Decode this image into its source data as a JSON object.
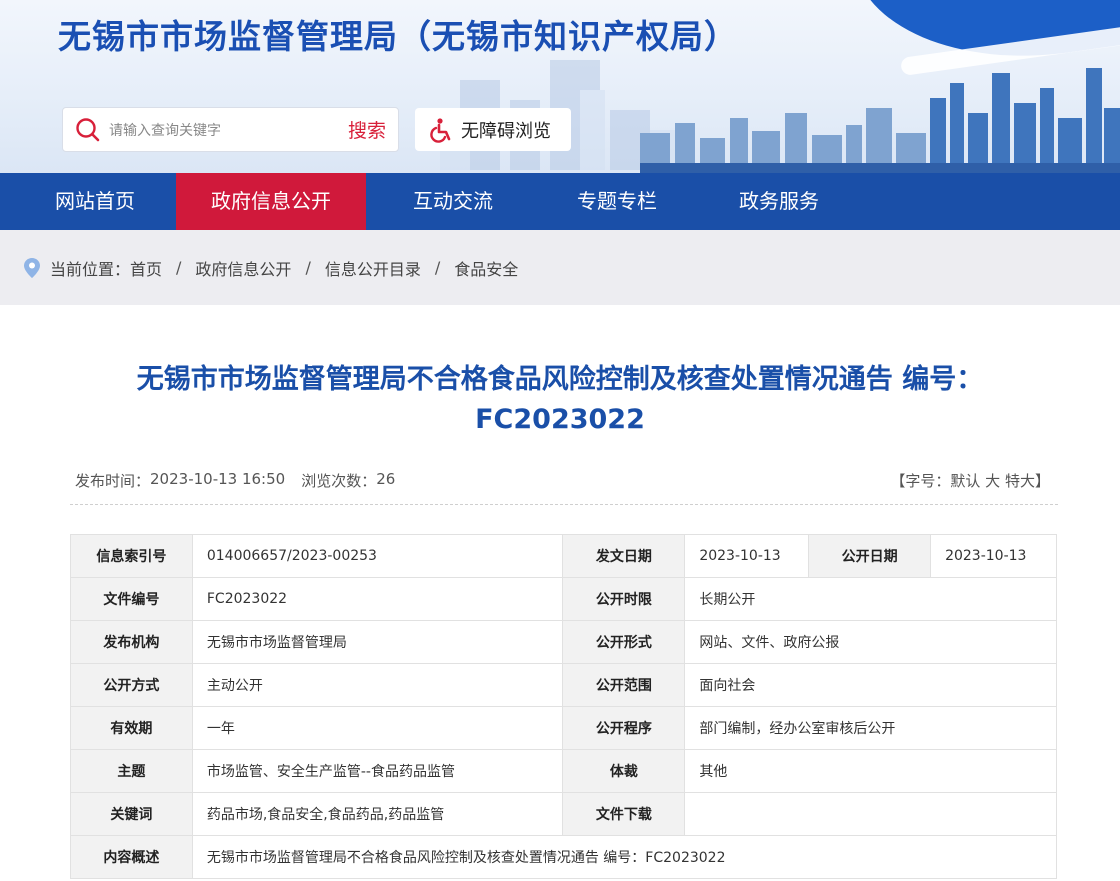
{
  "header": {
    "site_title": "无锡市市场监督管理局（无锡市知识产权局）",
    "search_placeholder": "请输入查询关键字",
    "search_button": "搜索",
    "accessibility_label": "无障碍浏览"
  },
  "nav": {
    "items": [
      {
        "label": "网站首页"
      },
      {
        "label": "政府信息公开"
      },
      {
        "label": "互动交流"
      },
      {
        "label": "专题专栏"
      },
      {
        "label": "政务服务"
      }
    ]
  },
  "breadcrumb": {
    "prefix": "当前位置：",
    "items": [
      "首页",
      "政府信息公开",
      "信息公开目录",
      "食品安全"
    ],
    "separator": "/"
  },
  "article": {
    "title": "无锡市市场监督管理局不合格食品风险控制及核查处置情况通告 编号：FC2023022",
    "publish_label": "发布时间：",
    "publish_time": "2023-10-13 16:50",
    "views_label": "浏览次数：",
    "views": "26",
    "font_size_prefix": "【字号：",
    "font_default": "默认",
    "font_large": "大",
    "font_xlarge": "特大",
    "font_size_suffix": "】"
  },
  "info_table": {
    "index_no": {
      "label": "信息索引号",
      "value": "014006657/2023-00253"
    },
    "issue_date": {
      "label": "发文日期",
      "value": "2023-10-13"
    },
    "open_date": {
      "label": "公开日期",
      "value": "2023-10-13"
    },
    "doc_no": {
      "label": "文件编号",
      "value": "FC2023022"
    },
    "open_period": {
      "label": "公开时限",
      "value": "长期公开"
    },
    "publisher": {
      "label": "发布机构",
      "value": "无锡市市场监督管理局"
    },
    "open_form": {
      "label": "公开形式",
      "value": "网站、文件、政府公报"
    },
    "open_method": {
      "label": "公开方式",
      "value": "主动公开"
    },
    "open_scope": {
      "label": "公开范围",
      "value": "面向社会"
    },
    "validity": {
      "label": "有效期",
      "value": "一年"
    },
    "open_procedure": {
      "label": "公开程序",
      "value": "部门编制，经办公室审核后公开"
    },
    "subject": {
      "label": "主题",
      "value": "市场监管、安全生产监管--食品药品监管"
    },
    "genre": {
      "label": "体裁",
      "value": "其他"
    },
    "keywords": {
      "label": "关键词",
      "value": "药品市场,食品安全,食品药品,药品监管"
    },
    "download": {
      "label": "文件下载",
      "value": ""
    },
    "summary": {
      "label": "内容概述",
      "value": "无锡市市场监督管理局不合格食品风险控制及核查处置情况通告 编号：FC2023022"
    }
  },
  "colors": {
    "brand_blue": "#1a4fa8",
    "active_red": "#d0193b",
    "title_blue": "#1a4fb3"
  }
}
